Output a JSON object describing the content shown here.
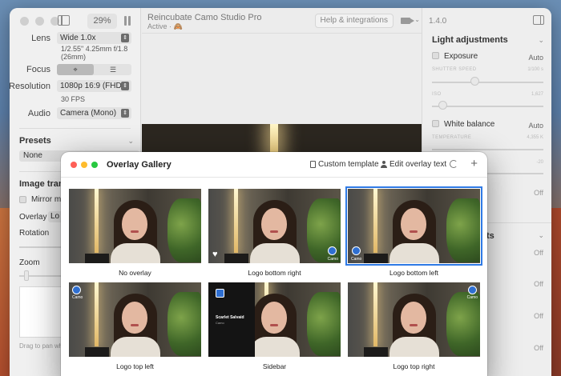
{
  "main_window": {
    "zoom": "29%",
    "app_name": "Reincubate Camo Studio Pro",
    "status": "Active · 🙈",
    "help_label": "Help & integrations",
    "version": "1.4.0"
  },
  "left_panel": {
    "lens_label": "Lens",
    "lens_value": "Wide 1.0x",
    "lens_spec_1": "1/2.55\" 4.25mm f/1.8",
    "lens_spec_2": "(26mm)",
    "focus_label": "Focus",
    "resolution_label": "Resolution",
    "resolution_value": "1080p 16:9 (FHD)",
    "fps": "30 FPS",
    "audio_label": "Audio",
    "audio_value": "Camera (Mono)",
    "presets_title": "Presets",
    "presets_value": "None",
    "image_transform_title": "Image transf",
    "mirror_label": "Mirror my",
    "overlay_label": "Overlay",
    "overlay_value": "Lo",
    "rotation_label": "Rotation",
    "zoom_label": "Zoom",
    "drag_hint": "Drag to pan wh"
  },
  "right_panel": {
    "light_title": "Light adjustments",
    "exposure_label": "Exposure",
    "exposure_value": "Auto",
    "shutter_label": "SHUTTER SPEED",
    "shutter_value": "1/100 s",
    "iso_label": "ISO",
    "iso_value": "1,627",
    "wb_label": "White balance",
    "wb_value": "Auto",
    "temp_label": "TEMPERATURE",
    "temp_value": "4,355 K",
    "tint_value": "-20",
    "off_1": "Off",
    "section2_fragment": "ts",
    "off_2": "Off",
    "off_3": "Off",
    "off_4": "Off",
    "off_5": "Off"
  },
  "gallery": {
    "title": "Overlay Gallery",
    "custom_template": "Custom template",
    "edit_overlay_text": "Edit overlay text",
    "badge_text": "Camo",
    "sidebar_name": "Scarlet Salvaid",
    "sidebar_sub": "Camo",
    "items": [
      {
        "label": "No overlay"
      },
      {
        "label": "Logo bottom right"
      },
      {
        "label": "Logo bottom left"
      },
      {
        "label": "Logo top left"
      },
      {
        "label": "Sidebar"
      },
      {
        "label": "Logo top right"
      }
    ]
  },
  "colors": {
    "accent": "#2f7ae5",
    "close": "#fe5f57",
    "minimize": "#febc2e",
    "zoom": "#28c840"
  }
}
